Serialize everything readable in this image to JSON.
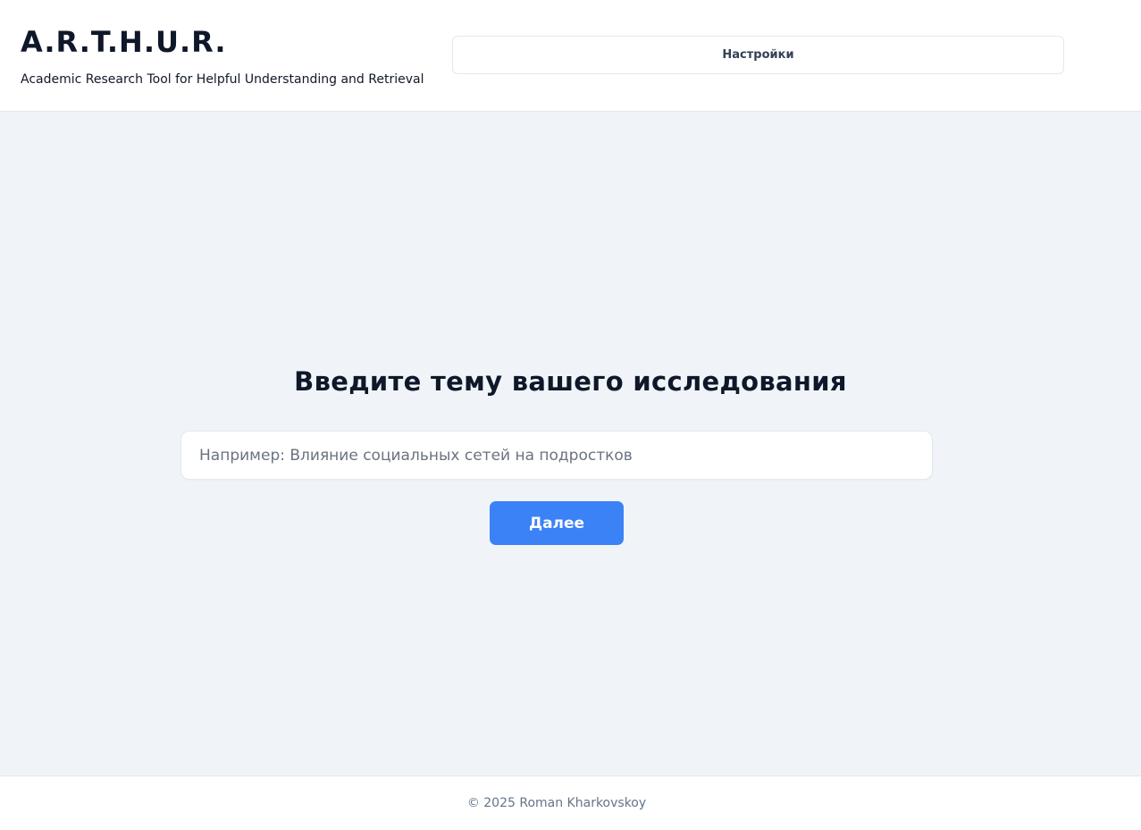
{
  "header": {
    "title": "A.R.T.H.U.R.",
    "subtitle": "Academic Research Tool for Helpful Understanding and Retrieval",
    "settings_label": "Настройки"
  },
  "main": {
    "heading": "Введите тему вашего исследования",
    "topic_input": {
      "value": "",
      "placeholder": "Например: Влияние социальных сетей на подростков"
    },
    "next_label": "Далее"
  },
  "footer": {
    "copyright": "© 2025 Roman Kharkovskoy"
  },
  "colors": {
    "accent": "#3b82f6",
    "background": "#f0f4f8",
    "heading_text": "#0f172a",
    "muted_text": "#64748b"
  }
}
